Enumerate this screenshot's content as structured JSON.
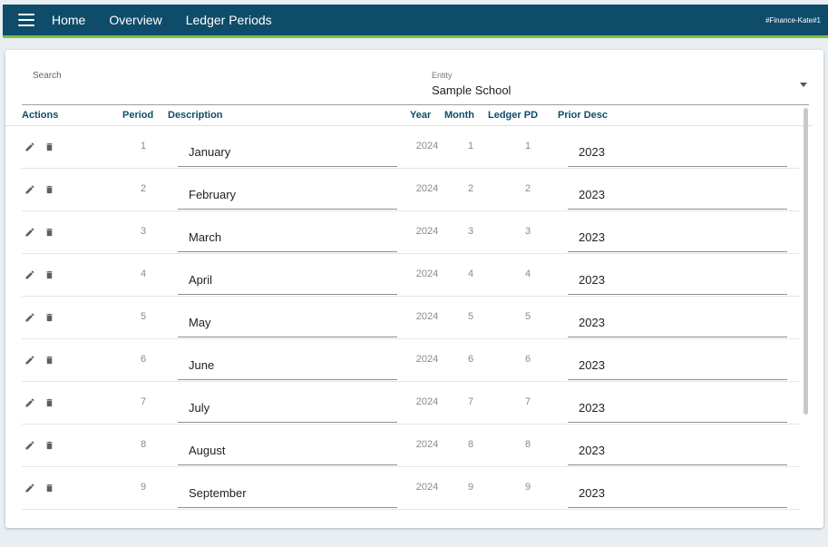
{
  "appbar": {
    "nav": [
      "Home",
      "Overview",
      "Ledger Periods"
    ],
    "tenant": "#Finance-Kate#1"
  },
  "filters": {
    "search_label": "Search",
    "entity_label": "Entity",
    "entity_value": "Sample School"
  },
  "table": {
    "columns": [
      "Actions",
      "Period",
      "Description",
      "Year",
      "Month",
      "Ledger PD",
      "Prior Desc"
    ],
    "rows": [
      {
        "period": "1",
        "description": "January",
        "year": "2024",
        "month": "1",
        "ledger_pd": "1",
        "prior_desc": "2023"
      },
      {
        "period": "2",
        "description": "February",
        "year": "2024",
        "month": "2",
        "ledger_pd": "2",
        "prior_desc": "2023"
      },
      {
        "period": "3",
        "description": "March",
        "year": "2024",
        "month": "3",
        "ledger_pd": "3",
        "prior_desc": "2023"
      },
      {
        "period": "4",
        "description": "April",
        "year": "2024",
        "month": "4",
        "ledger_pd": "4",
        "prior_desc": "2023"
      },
      {
        "period": "5",
        "description": "May",
        "year": "2024",
        "month": "5",
        "ledger_pd": "5",
        "prior_desc": "2023"
      },
      {
        "period": "6",
        "description": "June",
        "year": "2024",
        "month": "6",
        "ledger_pd": "6",
        "prior_desc": "2023"
      },
      {
        "period": "7",
        "description": "July",
        "year": "2024",
        "month": "7",
        "ledger_pd": "7",
        "prior_desc": "2023"
      },
      {
        "period": "8",
        "description": "August",
        "year": "2024",
        "month": "8",
        "ledger_pd": "8",
        "prior_desc": "2023"
      },
      {
        "period": "9",
        "description": "September",
        "year": "2024",
        "month": "9",
        "ledger_pd": "9",
        "prior_desc": "2023"
      }
    ]
  },
  "colors": {
    "appbar": "#0f4c6a",
    "accent_strip": "#7fbf3f",
    "header_text": "#0f4c6a"
  },
  "icons": [
    "menu-icon",
    "edit-icon",
    "delete-icon",
    "chevron-down-icon"
  ]
}
